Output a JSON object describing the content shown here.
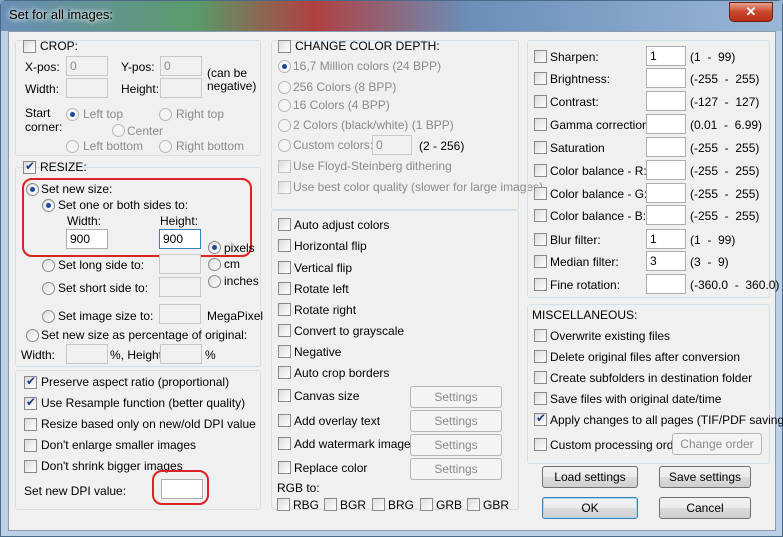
{
  "title": "Set for all images:",
  "close": "✕",
  "crop": {
    "label": "CROP:",
    "xpos": "X-pos:",
    "ypos": "Y-pos:",
    "xval": "0",
    "yval": "0",
    "width": "Width:",
    "height": "Height:",
    "canbe": "(can be",
    "negative": "negative)",
    "start": "Start",
    "corner": "corner:",
    "lefttop": "Left top",
    "righttop": "Right top",
    "center": "Center",
    "leftbottom": "Left bottom",
    "rightbottom": "Right bottom"
  },
  "resize": {
    "label": "RESIZE:",
    "setnew": "Set new size:",
    "onboth": "Set one or both sides to:",
    "width": "Width:",
    "height": "Height:",
    "wval": "900",
    "hval": "900",
    "pixels": "pixels",
    "cm": "cm",
    "inches": "inches",
    "longside": "Set long side to:",
    "shortside": "Set short side to:",
    "imagesize": "Set image size to:",
    "megapixel": "MegaPixel",
    "percentage": "Set new size as percentage of original:",
    "pwidth": "Width:",
    "pheight": "%, Height:",
    "pct": "%"
  },
  "options": {
    "preserve": "Preserve aspect ratio (proportional)",
    "resample": "Use Resample function (better quality)",
    "dpionly": "Resize based only on new/old DPI value",
    "noenlarge": "Don't enlarge smaller images",
    "noshrink": "Don't shrink bigger images",
    "dpi": "Set new DPI value:"
  },
  "depth": {
    "label": "CHANGE COLOR DEPTH:",
    "c24": "16,7 Million colors (24 BPP)",
    "c8": "256 Colors (8 BPP)",
    "c4": "16 Colors (4 BPP)",
    "c1": "2 Colors (black/white) (1 BPP)",
    "custom": "Custom colors:",
    "customval": "0",
    "range": "(2 - 256)",
    "floyd": "Use Floyd-Steinberg dithering",
    "bestq": "Use best color quality (slower for large images)"
  },
  "transforms": {
    "autoadjust": "Auto adjust colors",
    "hflip": "Horizontal flip",
    "vflip": "Vertical flip",
    "rleft": "Rotate left",
    "rright": "Rotate right",
    "gray": "Convert to grayscale",
    "negative": "Negative",
    "autocrop": "Auto crop borders",
    "canvas": "Canvas size",
    "overlay": "Add overlay text",
    "watermark": "Add watermark image",
    "replace": "Replace color",
    "settings": "Settings",
    "rgbto": "RGB to:",
    "rbg": "RBG",
    "bgr": "BGR",
    "brg": "BRG",
    "grb": "GRB",
    "gbr": "GBR"
  },
  "filters": {
    "sharpen": "Sharpen:",
    "sharpenval": "1",
    "sharpenrng": "(1  -  99)",
    "bright": "Brightness:",
    "brightrng": "(-255  -  255)",
    "contrast": "Contrast:",
    "contrastrng": "(-127  -  127)",
    "gamma": "Gamma correction:",
    "gammarng": "(0.01  -  6.99)",
    "saturation": "Saturation",
    "saturationrng": "(-255  -  255)",
    "cbr": "Color balance - R:",
    "cbrrng": "(-255  -  255)",
    "cbg": "Color balance - G:",
    "cbgrng": "(-255  -  255)",
    "cbb": "Color balance - B:",
    "cbbrng": "(-255  -  255)",
    "blur": "Blur filter:",
    "blurval": "1",
    "blurrng": "(1  -  99)",
    "median": "Median filter:",
    "medianval": "3",
    "medianrng": "(3  -  9)",
    "fine": "Fine rotation:",
    "finerng": "(-360.0  -  360.0)"
  },
  "misc": {
    "label": "MISCELLANEOUS:",
    "overwrite": "Overwrite existing files",
    "delete": "Delete original files after conversion",
    "subfolders": "Create subfolders in destination folder",
    "savedate": "Save files with original date/time",
    "allpages": "Apply changes to all pages (TIF/PDF saving)",
    "custom": "Custom processing order",
    "changeorder": "Change order"
  },
  "buttons": {
    "load": "Load settings",
    "save": "Save settings",
    "ok": "OK",
    "cancel": "Cancel"
  }
}
